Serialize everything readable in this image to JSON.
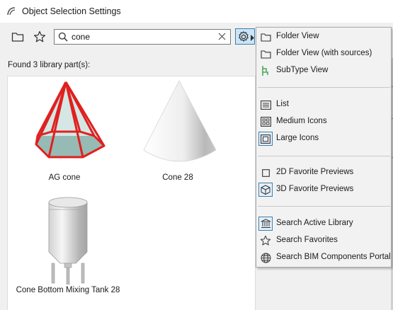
{
  "window": {
    "title": "Object Selection Settings"
  },
  "toolbar": {
    "folder_icon": "folder-icon",
    "favorite_icon": "star-icon",
    "search": {
      "value": "cone",
      "placeholder": ""
    },
    "settings_icon": "gear-icon"
  },
  "status": {
    "found_text": "Found 3 library part(s):"
  },
  "results": [
    {
      "name": "AG cone",
      "icon": "ag-cone-thumbnail"
    },
    {
      "name": "Cone 28",
      "icon": "cone-28-thumbnail"
    },
    {
      "name": "Cone Bottom Mixing Tank 28",
      "icon": "mixing-tank-thumbnail"
    }
  ],
  "menu": {
    "groups": [
      {
        "items": [
          {
            "label": "Folder View",
            "icon": "folder-icon",
            "selected": false
          },
          {
            "label": "Folder View (with sources)",
            "icon": "folder-icon",
            "selected": false
          },
          {
            "label": "SubType View",
            "icon": "subtype-icon",
            "selected": false
          }
        ]
      },
      {
        "items": [
          {
            "label": "List",
            "icon": "list-icon",
            "selected": false
          },
          {
            "label": "Medium Icons",
            "icon": "medium-icons-icon",
            "selected": false
          },
          {
            "label": "Large Icons",
            "icon": "large-icons-icon",
            "selected": true
          }
        ]
      },
      {
        "items": [
          {
            "label": "2D Favorite Previews",
            "icon": "square-icon",
            "selected": false
          },
          {
            "label": "3D Favorite Previews",
            "icon": "cube-icon",
            "selected": true
          }
        ]
      },
      {
        "items": [
          {
            "label": "Search Active Library",
            "icon": "library-icon",
            "selected": true
          },
          {
            "label": "Search Favorites",
            "icon": "star-icon",
            "selected": false
          },
          {
            "label": "Search BIM Components Portal",
            "icon": "globe-icon",
            "selected": false
          }
        ]
      }
    ]
  },
  "colors": {
    "accent_border": "#3c7fb1",
    "accent_fill": "#cce4f7",
    "subtype_green": "#2a9a3c",
    "ag_cone_red": "#e02020"
  }
}
